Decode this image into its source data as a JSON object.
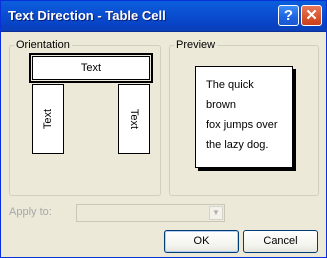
{
  "window": {
    "title": "Text Direction - Table Cell",
    "help_glyph": "?",
    "close_glyph": "✕"
  },
  "orientation": {
    "label": "Orientation",
    "options": [
      {
        "label": "Text",
        "direction": "horizontal",
        "selected": true
      },
      {
        "label": "Text",
        "direction": "vertical-up",
        "selected": false
      },
      {
        "label": "Text",
        "direction": "vertical-down",
        "selected": false
      }
    ]
  },
  "preview": {
    "label": "Preview",
    "lines": [
      "The quick brown",
      "fox jumps over",
      "the lazy dog."
    ]
  },
  "apply_to": {
    "label": "Apply to:",
    "value": "",
    "enabled": false
  },
  "buttons": {
    "ok": "OK",
    "cancel": "Cancel"
  }
}
